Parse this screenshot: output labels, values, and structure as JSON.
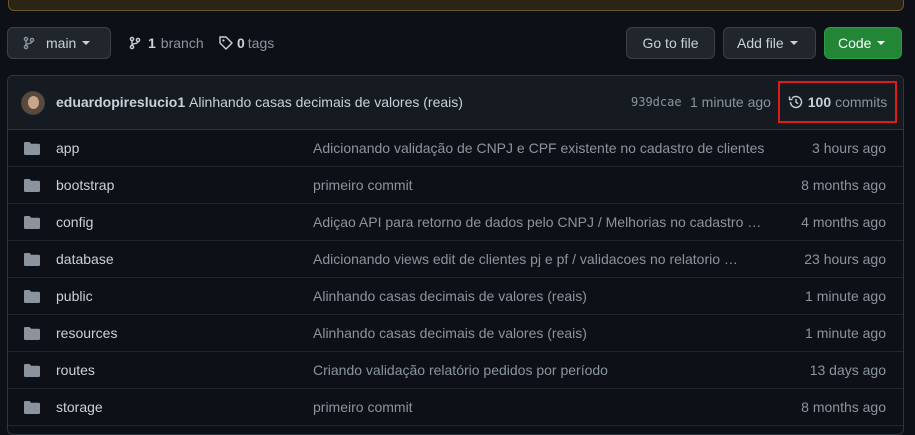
{
  "repo": {
    "branch_label": "main",
    "branches_count": "1",
    "branches_label": "branch",
    "tags_count": "0",
    "tags_label": "tags",
    "goto_file_label": "Go to file",
    "add_file_label": "Add file",
    "code_label": "Code"
  },
  "latest_commit": {
    "author": "eduardopireslucio1",
    "message": "Alinhando casas decimais de valores (reais)",
    "sha": "939dcae",
    "time": "1 minute ago",
    "commits_count": "100",
    "commits_label": "commits"
  },
  "files": [
    {
      "name": "app",
      "message": "Adicionando validação de CNPJ e CPF existente no cadastro de clientes",
      "time": "3 hours ago"
    },
    {
      "name": "bootstrap",
      "message": "primeiro commit",
      "time": "8 months ago"
    },
    {
      "name": "config",
      "message": "Adiçao API para retorno de dados pelo CNPJ / Melhorias no cadastro d…",
      "time": "4 months ago"
    },
    {
      "name": "database",
      "message": "Adicionando views edit de clientes pj e pf / validacoes no relatorio …",
      "time": "23 hours ago"
    },
    {
      "name": "public",
      "message": "Alinhando casas decimais de valores (reais)",
      "time": "1 minute ago"
    },
    {
      "name": "resources",
      "message": "Alinhando casas decimais de valores (reais)",
      "time": "1 minute ago"
    },
    {
      "name": "routes",
      "message": "Criando validação relatório pedidos por período",
      "time": "13 days ago"
    },
    {
      "name": "storage",
      "message": "primeiro commit",
      "time": "8 months ago"
    }
  ],
  "colors": {
    "background": "#0d1117",
    "code_button": "#238636",
    "highlight_border": "#e01919",
    "folder_icon": "#8b949e"
  }
}
